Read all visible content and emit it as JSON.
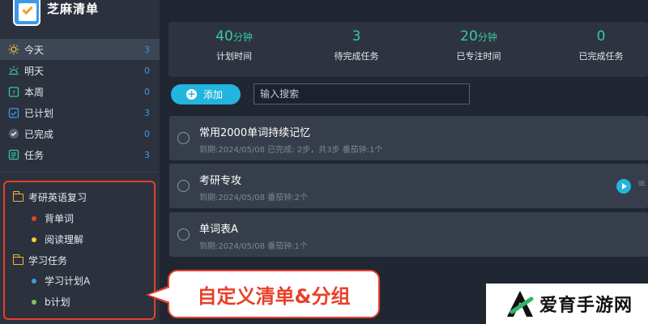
{
  "app": {
    "title": "芝麻清单"
  },
  "nav": [
    {
      "label": "今天",
      "count": "3",
      "icon": "sun-icon",
      "color": "#f2b632"
    },
    {
      "label": "明天",
      "count": "0",
      "icon": "sunrise-icon",
      "color": "#39c9a0"
    },
    {
      "label": "本周",
      "count": "0",
      "icon": "calendar-week-icon",
      "color": "#39c9a0"
    },
    {
      "label": "已计划",
      "count": "3",
      "icon": "calendar-check-icon",
      "color": "#3a9ae8"
    },
    {
      "label": "已完成",
      "count": "0",
      "icon": "check-circle-icon",
      "color": "#8e96a3"
    },
    {
      "label": "任务",
      "count": "3",
      "icon": "list-icon",
      "color": "#39c9a0"
    }
  ],
  "lists": {
    "groups": [
      {
        "label": "考研英语复习",
        "items": [
          {
            "label": "背单词",
            "color": "#e8402a"
          },
          {
            "label": "阅读理解",
            "color": "#f2d132"
          }
        ]
      },
      {
        "label": "学习任务",
        "items": [
          {
            "label": "学习计划A",
            "color": "#3a9ae8"
          },
          {
            "label": "b计划",
            "color": "#8bc34a"
          }
        ]
      }
    ]
  },
  "stats": [
    {
      "value": "40",
      "unit": "分钟",
      "label": "计划时间"
    },
    {
      "value": "3",
      "unit": "",
      "label": "待完成任务"
    },
    {
      "value": "20",
      "unit": "分钟",
      "label": "已专注时间"
    },
    {
      "value": "0",
      "unit": "",
      "label": "已完成任务"
    }
  ],
  "toolbar": {
    "add_label": "添加",
    "search_placeholder": "输入搜索"
  },
  "tasks": [
    {
      "title": "常用2000单词持续记忆",
      "meta": "到期:2024/05/08 已完成: 2步，共3步 番茄钟:1个"
    },
    {
      "title": "考研专攻",
      "meta": "到期:2024/05/08 番茄钟:2个",
      "more": "≡"
    },
    {
      "title": "单词表A",
      "meta": "到期:2024/05/08 番茄钟:1个"
    }
  ],
  "callout": {
    "text": "自定义清单&分组"
  },
  "watermark": {
    "text": "爱育手游网"
  },
  "colors": {
    "accent": "#21b5e0",
    "stat": "#39c9a0",
    "highlight": "#e8402a"
  }
}
